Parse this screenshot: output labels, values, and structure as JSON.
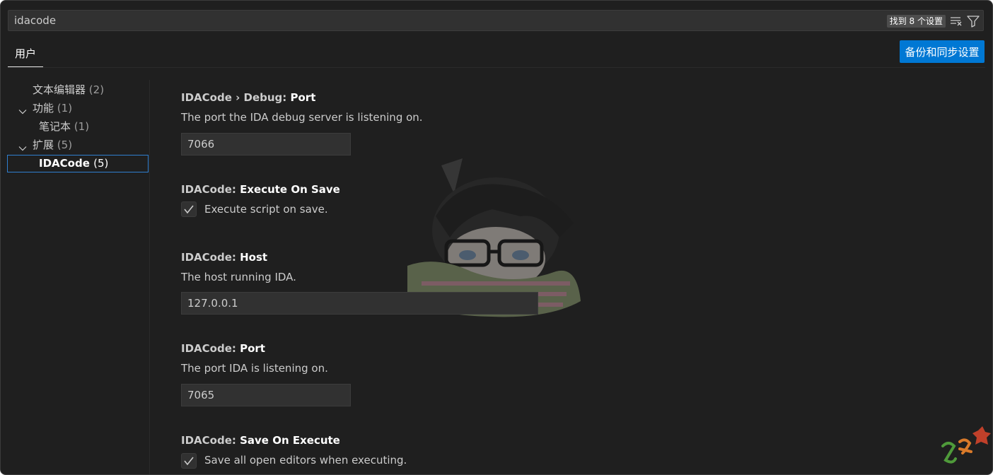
{
  "search": {
    "value": "idacode",
    "result_badge": "找到 8 个设置",
    "clear_icon": "clear-filter-icon",
    "filter_icon": "funnel-icon"
  },
  "tabs": [
    {
      "label": "用户",
      "active": true
    }
  ],
  "sync_button": {
    "label": "备份和同步设置"
  },
  "toc": {
    "items": [
      {
        "label": "文本编辑器",
        "count": "(2)",
        "expandable": false
      },
      {
        "label": "功能",
        "count": "(1)",
        "expandable": true,
        "expanded": true
      },
      {
        "label": "笔记本",
        "count": "(1)",
        "expandable": false
      },
      {
        "label": "扩展",
        "count": "(5)",
        "expandable": true,
        "expanded": true
      },
      {
        "label": "IDACode",
        "count": "(5)",
        "selected": true
      }
    ]
  },
  "settings": [
    {
      "category": "IDACode › Debug: ",
      "key": "Port",
      "description": "The port the IDA debug server is listening on.",
      "type": "text",
      "value": "7066"
    },
    {
      "category": "IDACode: ",
      "key": "Execute On Save",
      "type": "checkbox",
      "checked": true,
      "checkbox_label": "Execute script on save."
    },
    {
      "category": "IDACode: ",
      "key": "Host",
      "description": "The host running IDA.",
      "type": "text",
      "value": "127.0.0.1"
    },
    {
      "category": "IDACode: ",
      "key": "Port",
      "description": "The port IDA is listening on.",
      "type": "text",
      "value": "7065"
    },
    {
      "category": "IDACode: ",
      "key": "Save On Execute",
      "type": "checkbox",
      "checked": true,
      "checkbox_label": "Save all open editors when executing."
    }
  ],
  "colors": {
    "background": "#1f1f1f",
    "accent": "#0078d4",
    "input_bg": "#313131"
  }
}
